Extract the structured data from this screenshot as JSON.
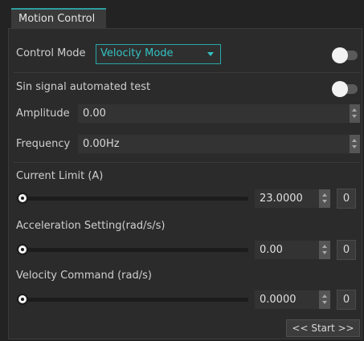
{
  "tab": {
    "label": "Motion Control"
  },
  "control_mode": {
    "label": "Control Mode",
    "selected": "Velocity Mode",
    "enabled": false
  },
  "sin_test": {
    "label": "Sin signal automated test",
    "enabled": false,
    "amplitude": {
      "label": "Amplitude",
      "value": "0.00"
    },
    "frequency": {
      "label": "Frequency",
      "value": "0.00Hz"
    }
  },
  "current_limit": {
    "label": "Current Limit (A)",
    "value": "23.0000",
    "reset_label": "0",
    "slider_fraction": 0
  },
  "acceleration": {
    "label": "Acceleration Setting(rad/s/s)",
    "value": "0.00",
    "reset_label": "0",
    "slider_fraction": 0
  },
  "velocity": {
    "label": "Velocity Command (rad/s)",
    "value": "0.0000",
    "reset_label": "0",
    "slider_fraction": 0
  },
  "start_button": {
    "label": "<< Start >>"
  },
  "colors": {
    "accent": "#2aa8a8",
    "background": "#2b2b2b",
    "text": "#cfcfcf"
  }
}
